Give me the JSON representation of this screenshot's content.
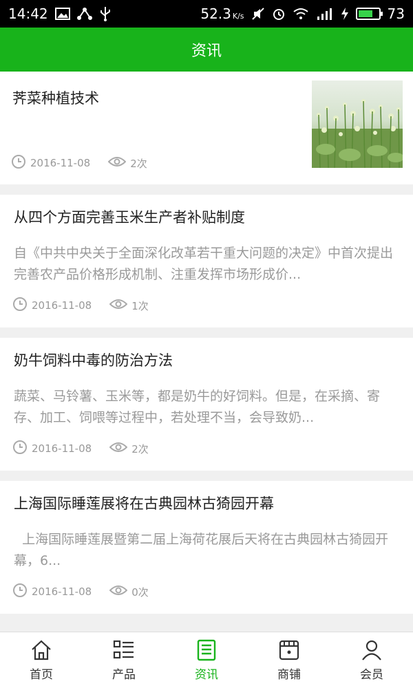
{
  "status_bar": {
    "time": "14:42",
    "net_speed": "52.3",
    "net_speed_unit": "K/s",
    "battery_level": "73",
    "battery_fraction": 0.73
  },
  "header": {
    "title": "资讯"
  },
  "articles": [
    {
      "title": "荠菜种植技术",
      "summary": "",
      "date": "2016-11-08",
      "views": "2次"
    },
    {
      "title": "从四个方面完善玉米生产者补贴制度",
      "summary": "自《中共中央关于全面深化改革若干重大问题的决定》中首次提出完善农产品价格形成机制、注重发挥市场形成价...",
      "date": "2016-11-08",
      "views": "1次"
    },
    {
      "title": "奶牛饲料中毒的防治方法",
      "summary": "蔬菜、马铃薯、玉米等，都是奶牛的好饲料。但是，在采摘、寄存、加工、饲喂等过程中，若处理不当，会导致奶...",
      "date": "2016-11-08",
      "views": "2次"
    },
    {
      "title": "上海国际睡莲展将在古典园林古猗园开幕",
      "summary": "  上海国际睡莲展暨第二届上海荷花展后天将在古典园林古猗园开幕，6...",
      "date": "2016-11-08",
      "views": "0次"
    }
  ],
  "tabbar": {
    "items": [
      {
        "label": "首页",
        "icon": "home-icon"
      },
      {
        "label": "产品",
        "icon": "list-icon"
      },
      {
        "label": "资讯",
        "icon": "news-icon",
        "active": true
      },
      {
        "label": "商铺",
        "icon": "shop-icon"
      },
      {
        "label": "会员",
        "icon": "user-icon"
      }
    ]
  },
  "colors": {
    "accent": "#18b31b",
    "text": "#222222",
    "muted": "#999999"
  }
}
